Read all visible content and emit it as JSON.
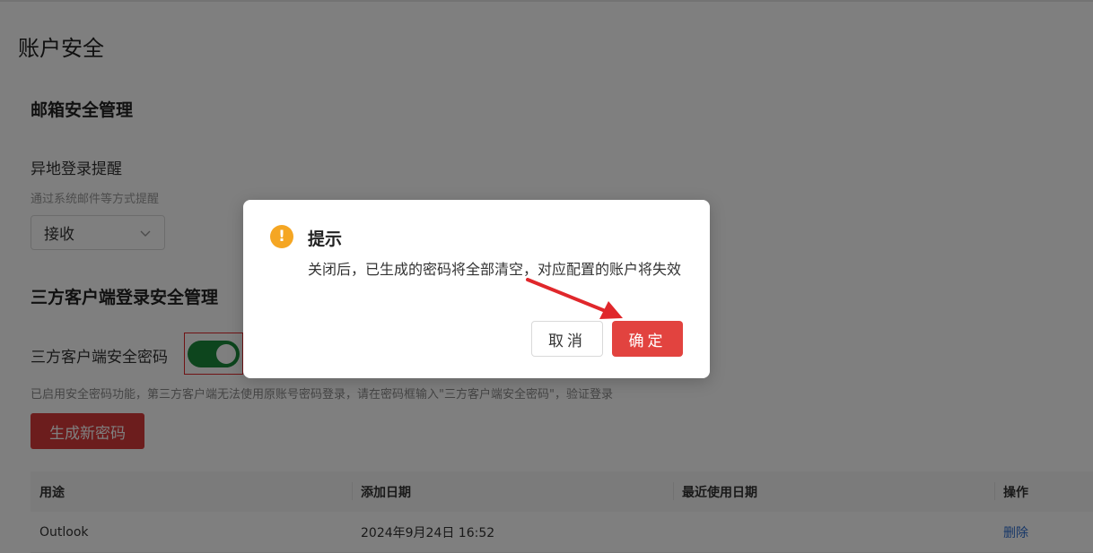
{
  "page": {
    "title": "账户安全"
  },
  "email_security": {
    "heading": "邮箱安全管理",
    "remote_login_label": "异地登录提醒",
    "remote_login_hint": "通过系统邮件等方式提醒",
    "select_value": "接收"
  },
  "third_party": {
    "heading": "三方客户端登录安全管理",
    "password_label": "三方客户端安全密码",
    "toggle_on": true,
    "description": "已启用安全密码功能，第三方客户端无法使用原账号密码登录，请在密码框输入\"三方客户端安全密码\"，验证登录",
    "generate_button": "生成新密码"
  },
  "table": {
    "headers": [
      "用途",
      "添加日期",
      "最近使用日期",
      "操作"
    ],
    "rows": [
      {
        "usage": "Outlook",
        "added": "2024年9月24日 16:52",
        "last_used": "",
        "action": "删除"
      }
    ]
  },
  "dialog": {
    "title": "提示",
    "icon": "warning-icon",
    "message": "关闭后，已生成的密码将全部清空，对应配置的账户将失效",
    "cancel_label": "取消",
    "ok_label": "确定"
  },
  "colors": {
    "accent_red": "#e2433f",
    "toggle_green": "#1a8a3a",
    "warning_orange": "#f5a623",
    "link_blue": "#2f6fd0"
  }
}
